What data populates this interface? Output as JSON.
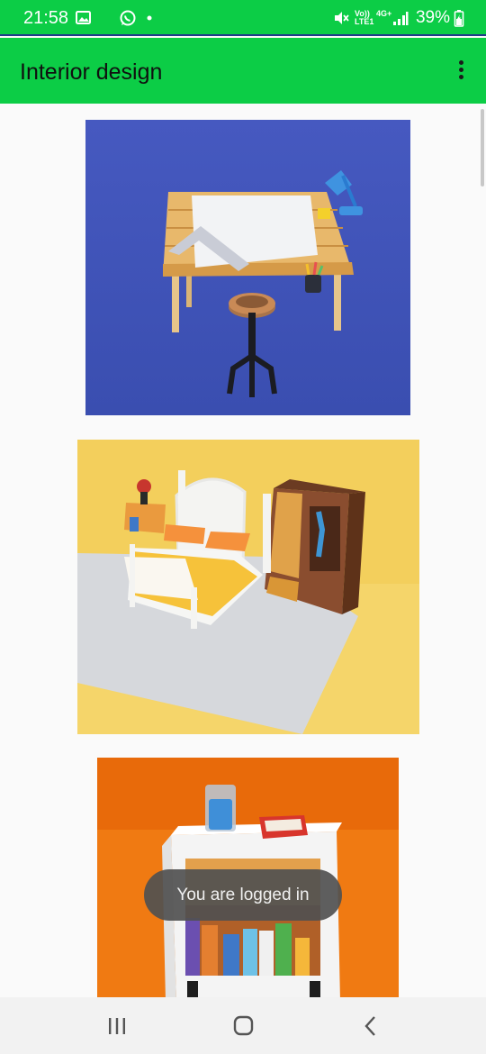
{
  "status_bar": {
    "time": "21:58",
    "battery": "39%",
    "network_volte": "Vo)) LTE1",
    "network_4g": "4G+",
    "icons": [
      "gallery-icon",
      "whatsapp-icon",
      "notification-dot-icon",
      "mute-icon",
      "signal-icon",
      "battery-icon"
    ]
  },
  "app_bar": {
    "title": "Interior design",
    "menu_icon": "more-vert-icon"
  },
  "gallery": [
    {
      "subject": "drafting-table-with-stool",
      "background": "#3f55b8"
    },
    {
      "subject": "bed-with-nightstand-and-wardrobe",
      "background": "#f5d56a"
    },
    {
      "subject": "nightstand-with-books",
      "background": "#f07a12"
    }
  ],
  "toast": {
    "message": "You are logged in"
  },
  "colors": {
    "primary": "#0ccd46",
    "status_accent": "#203a8a"
  },
  "nav_bar": {
    "icons": [
      "recents-icon",
      "home-icon",
      "back-icon"
    ]
  }
}
